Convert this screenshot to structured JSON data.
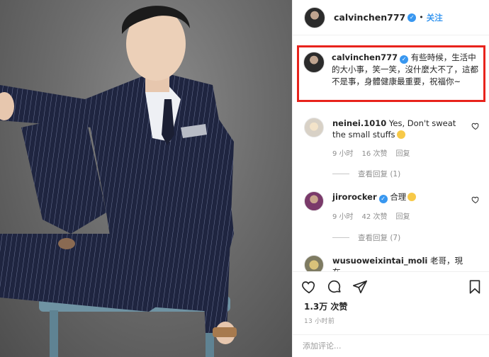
{
  "post": {
    "username": "calvinchen777",
    "dot": "•",
    "follow_label": "关注"
  },
  "caption": {
    "username": "calvinchen777",
    "text": "有些時候，生活中的大小事，笑一笑，沒什麼大不了，這都不是事，身體健康最重要，祝福你~"
  },
  "comments": [
    {
      "username": "neinei.1010",
      "text": "Yes, Don't sweat the small stuffs",
      "time": "9 小时",
      "likes": "16 次赞",
      "reply": "回复",
      "view_replies": "查看回复 (1)"
    },
    {
      "username": "jirorocker",
      "text": "合理",
      "time": "9 小时",
      "likes": "42 次赞",
      "reply": "回复",
      "view_replies": "查看回复 (7)"
    },
    {
      "username": "wusuoweixintai_moli",
      "text": "老哥，現在"
    }
  ],
  "stats": {
    "views": "1.3万 次赞",
    "time": "13 小时前"
  },
  "add_comment": {
    "placeholder": "添加评论..."
  },
  "colors": {
    "highlight_border": "#e8231c",
    "link_blue": "#3897f0",
    "muted": "#8e8e8e"
  }
}
